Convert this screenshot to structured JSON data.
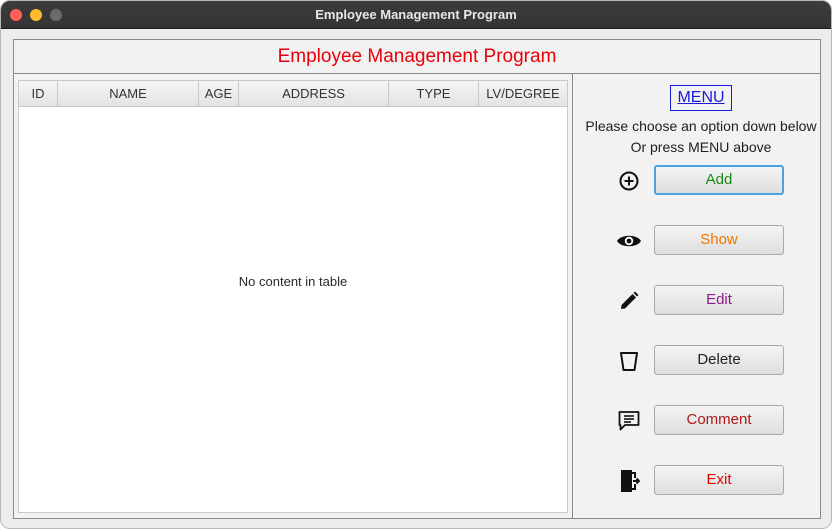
{
  "window": {
    "title": "Employee Management Program"
  },
  "banner": {
    "title": "Employee Management Program",
    "color": "#e8000b"
  },
  "table": {
    "columns": [
      "ID",
      "NAME",
      "AGE",
      "ADDRESS",
      "TYPE",
      "LV/DEGREE"
    ],
    "empty_text": "No content in table"
  },
  "menu": {
    "title": "MENU",
    "hint_line1": "Please choose an option down below",
    "hint_line2": "Or press MENU above",
    "buttons": [
      {
        "label": "Add",
        "icon": "plus-circle-icon",
        "color": "#148a14"
      },
      {
        "label": "Show",
        "icon": "eye-icon",
        "color": "#f07800"
      },
      {
        "label": "Edit",
        "icon": "pencil-icon",
        "color": "#8a1e8a"
      },
      {
        "label": "Delete",
        "icon": "trash-icon",
        "color": "#222222"
      },
      {
        "label": "Comment",
        "icon": "comment-icon",
        "color": "#b01a1a"
      },
      {
        "label": "Exit",
        "icon": "exit-door-icon",
        "color": "#e00000"
      }
    ]
  }
}
